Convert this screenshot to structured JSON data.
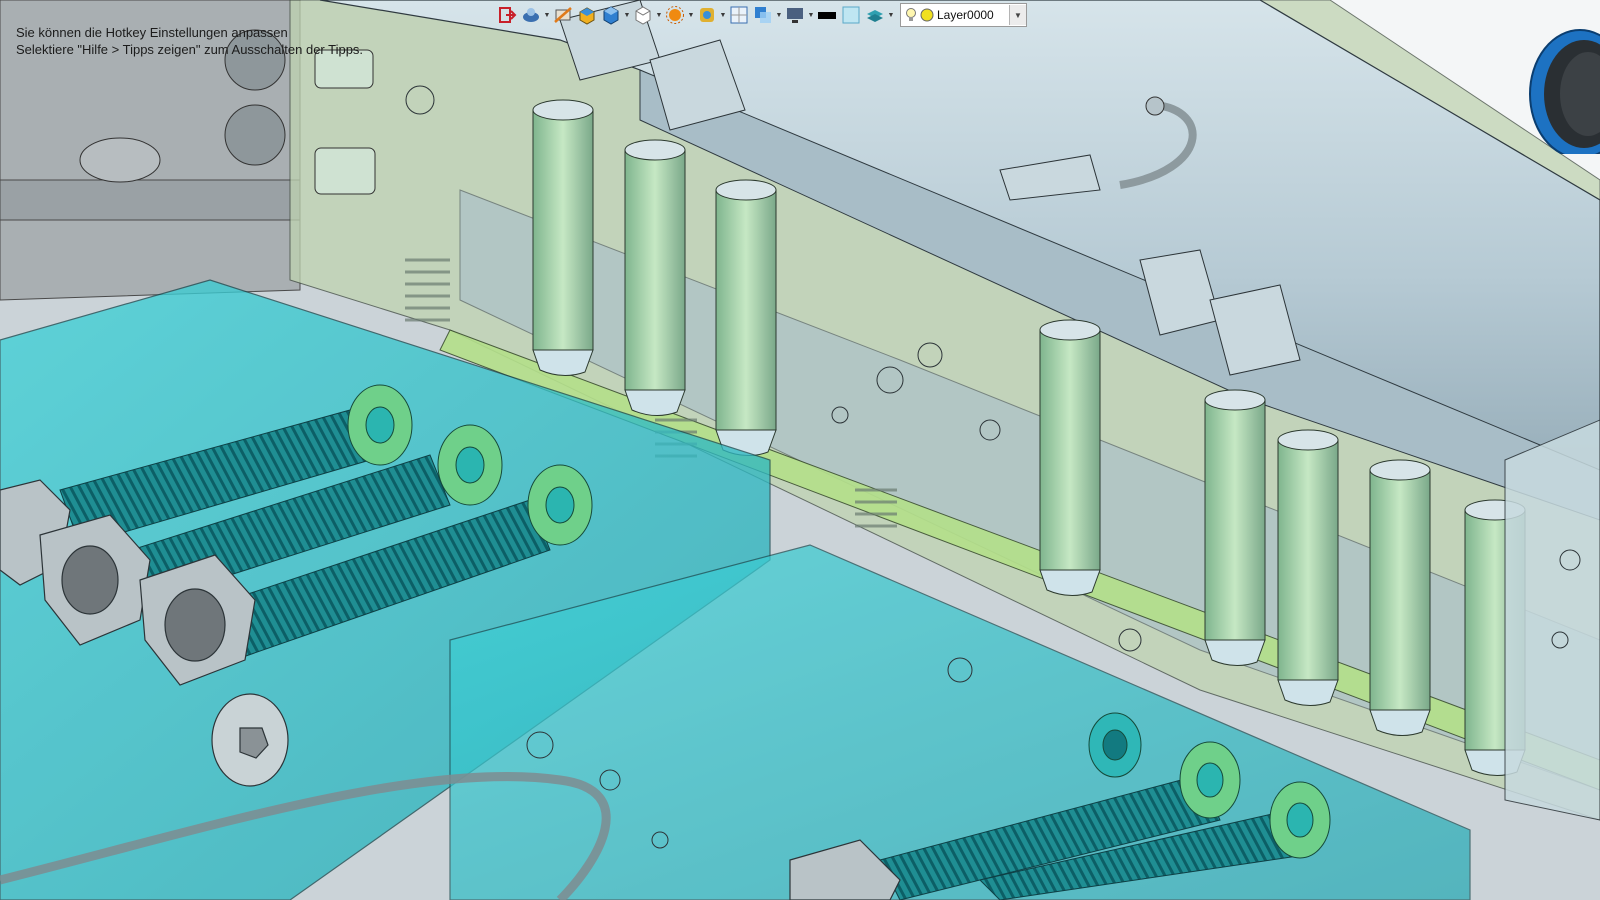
{
  "tips": {
    "line1": "Sie können die Hotkey Einstellungen anpassen",
    "line2": "Selektiere \"Hilfe > Tipps zeigen\" zum Ausschalten der Tipps."
  },
  "toolbar": {
    "buttons": [
      {
        "name": "exit-icon",
        "color": "#c8202a"
      },
      {
        "name": "view-orient-icon",
        "color": "#3a6fb0",
        "dropdown": true
      },
      {
        "name": "section-view-icon",
        "color": "#e07a1a"
      },
      {
        "name": "box-shaded-icon",
        "color": "#f0b020"
      },
      {
        "name": "cube-blue-icon",
        "color": "#2f7fd0",
        "dropdown": true
      },
      {
        "name": "cube-white-icon",
        "color": "#ffffff",
        "dropdown": true
      },
      {
        "name": "sun-render-icon",
        "color": "#f08a10",
        "dropdown": true
      },
      {
        "name": "texture-icon",
        "color": "#e0b030",
        "dropdown": true
      },
      {
        "name": "grid-view-icon",
        "color": "#3a6fb0"
      },
      {
        "name": "transparency-icon",
        "color": "#2f7fd0",
        "dropdown": true
      },
      {
        "name": "display-monitor-icon",
        "color": "#4a6080",
        "dropdown": true
      },
      {
        "name": "color-black-swatch-icon",
        "color": "#000000"
      },
      {
        "name": "color-light-swatch-icon",
        "color": "#bfe6f2"
      },
      {
        "name": "layer-stack-icon",
        "color": "#2fa0b0",
        "dropdown": true
      }
    ]
  },
  "layer": {
    "name": "Layer0000",
    "on_icon": "lightbulb-icon",
    "color_icon": "layer-color-circle-icon",
    "color": "#f0e020"
  },
  "colors": {
    "background": "#cfd6da",
    "pipe": "#b9cdd6",
    "cyan_block": "#39c8d0",
    "green_block": "#b7d9a0",
    "nozzle": "#9ecfa8"
  }
}
